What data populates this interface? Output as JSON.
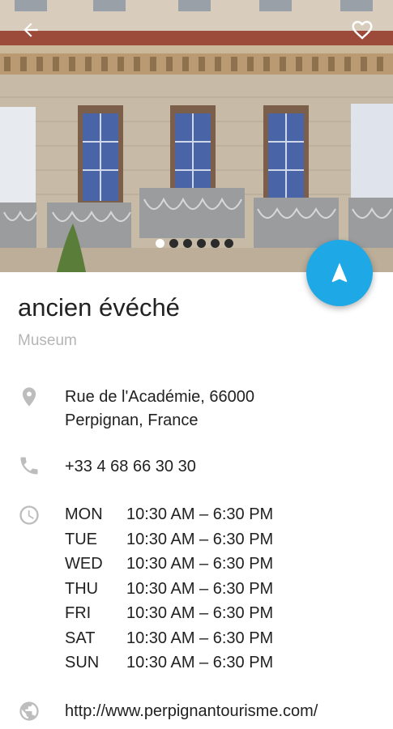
{
  "header": {
    "back_icon": "arrow-back-icon",
    "favorite_icon": "heart-outline-icon"
  },
  "gallery": {
    "image_count": 6,
    "active_index": 0
  },
  "fab": {
    "icon": "navigation-icon",
    "color": "#1fa8e6"
  },
  "place": {
    "name": "ancien évéché",
    "category": "Museum",
    "address_line1": "Rue de l'Académie, 66000",
    "address_line2": "Perpignan, France",
    "phone": "+33 4 68 66 30 30",
    "website": "http://www.perpignantourisme.com/"
  },
  "hours": [
    {
      "day": "MON",
      "time": "10:30 AM – 6:30 PM"
    },
    {
      "day": "TUE",
      "time": "10:30 AM – 6:30 PM"
    },
    {
      "day": "WED",
      "time": "10:30 AM – 6:30 PM"
    },
    {
      "day": "THU",
      "time": "10:30 AM – 6:30 PM"
    },
    {
      "day": "FRI",
      "time": "10:30 AM – 6:30 PM"
    },
    {
      "day": "SAT",
      "time": "10:30 AM – 6:30 PM"
    },
    {
      "day": "SUN",
      "time": "10:30 AM – 6:30 PM"
    }
  ]
}
